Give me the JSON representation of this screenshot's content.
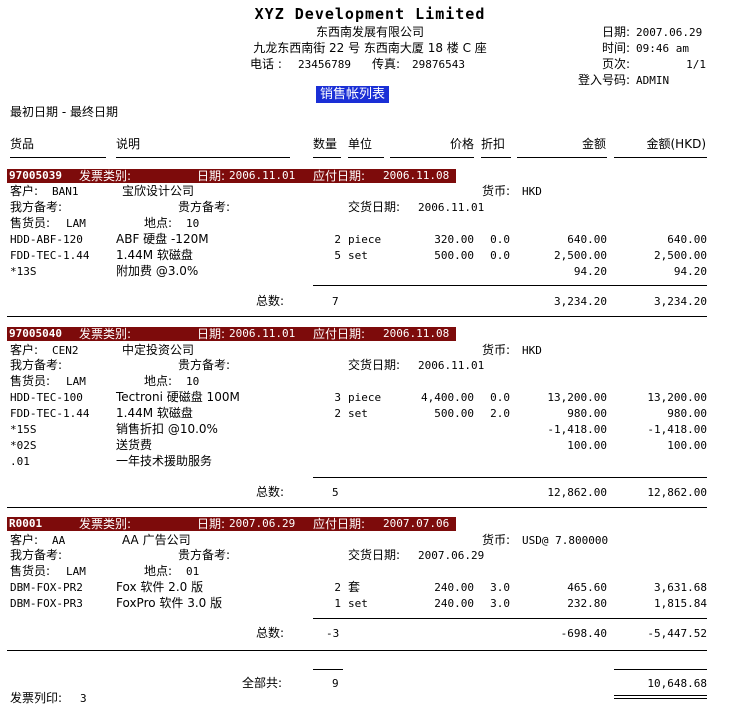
{
  "header": {
    "company_en": "XYZ Development Limited",
    "company_cn": "东西南发展有限公司",
    "address": "九龙东西南街 22 号 东西南大厦 18 楼 C 座",
    "phone_label": "电话 :",
    "phone": "23456789",
    "fax_label": "传真:",
    "fax": "29876543",
    "report_title": "销售帐列表",
    "date_range": "最初日期 - 最终日期",
    "meta": [
      {
        "label": "日期:",
        "value": "2007.06.29"
      },
      {
        "label": "时间:",
        "value": "09:46 am"
      },
      {
        "label": "页次:",
        "value": "1/1"
      },
      {
        "label": "登入号码:",
        "value": "ADMIN"
      }
    ]
  },
  "columns": {
    "item": "货品",
    "desc": "说明",
    "qty": "数量",
    "unit": "单位",
    "price": "价格",
    "discount": "折扣",
    "amount": "金额",
    "amount_hkd": "金额(HKD)"
  },
  "labels": {
    "invoice_type": "发票类别:",
    "date": "日期:",
    "due_date": "应付日期:",
    "customer": "客户:",
    "our_ref": "我方备考:",
    "your_ref": "贵方备考:",
    "delivery_date": "交货日期:",
    "currency": "货币:",
    "salesman": "售货员:",
    "location": "地点:",
    "subtotal": "总数:",
    "grand_total": "全部共:",
    "print_count_label": "发票列印:"
  },
  "invoices": [
    {
      "no": "97005039",
      "date": "2006.11.01",
      "due": "2006.11.08",
      "customer_code": "BAN1",
      "customer_name": "宝欣设计公司",
      "currency": "HKD",
      "delivery": "2006.11.01",
      "salesman": "LAM",
      "location": "10",
      "lines": [
        {
          "item": "HDD-ABF-120",
          "desc": "ABF 硬盘 -120M",
          "qty": "2",
          "unit": "piece",
          "price": "320.00",
          "disc": "0.0",
          "amount": "640.00",
          "hkd": "640.00"
        },
        {
          "item": "FDD-TEC-1.44",
          "desc": "1.44M 软磁盘",
          "qty": "5",
          "unit": "set",
          "price": "500.00",
          "disc": "0.0",
          "amount": "2,500.00",
          "hkd": "2,500.00"
        },
        {
          "item": "*13S",
          "desc": "附加费 @3.0%",
          "qty": "",
          "unit": "",
          "price": "",
          "disc": "",
          "amount": "94.20",
          "hkd": "94.20"
        }
      ],
      "total_qty": "7",
      "total_amount": "3,234.20",
      "total_hkd": "3,234.20"
    },
    {
      "no": "97005040",
      "date": "2006.11.01",
      "due": "2006.11.08",
      "customer_code": "CEN2",
      "customer_name": "中定投资公司",
      "currency": "HKD",
      "delivery": "2006.11.01",
      "salesman": "LAM",
      "location": "10",
      "lines": [
        {
          "item": "HDD-TEC-100",
          "desc": "Tectroni 硬磁盘 100M",
          "qty": "3",
          "unit": "piece",
          "price": "4,400.00",
          "disc": "0.0",
          "amount": "13,200.00",
          "hkd": "13,200.00"
        },
        {
          "item": "FDD-TEC-1.44",
          "desc": "1.44M 软磁盘",
          "qty": "2",
          "unit": "set",
          "price": "500.00",
          "disc": "2.0",
          "amount": "980.00",
          "hkd": "980.00"
        },
        {
          "item": "*15S",
          "desc": "销售折扣 @10.0%",
          "qty": "",
          "unit": "",
          "price": "",
          "disc": "",
          "amount": "-1,418.00",
          "hkd": "-1,418.00"
        },
        {
          "item": "*02S",
          "desc": "送货费",
          "qty": "",
          "unit": "",
          "price": "",
          "disc": "",
          "amount": "100.00",
          "hkd": "100.00"
        },
        {
          "item": ".01",
          "desc": "一年技术援助服务",
          "qty": "",
          "unit": "",
          "price": "",
          "disc": "",
          "amount": "",
          "hkd": ""
        }
      ],
      "total_qty": "5",
      "total_amount": "12,862.00",
      "total_hkd": "12,862.00"
    },
    {
      "no": "R0001",
      "date": "2007.06.29",
      "due": "2007.07.06",
      "customer_code": "AA",
      "customer_name": "AA 广告公司",
      "currency": "USD@  7.800000",
      "delivery": "2007.06.29",
      "salesman": "LAM",
      "location": "01",
      "lines": [
        {
          "item": "DBM-FOX-PR2",
          "desc": "Fox 软件 2.0 版",
          "qty": "2",
          "unit": "套",
          "price": "240.00",
          "disc": "3.0",
          "amount": "465.60",
          "hkd": "3,631.68"
        },
        {
          "item": "DBM-FOX-PR3",
          "desc": "FoxPro 软件 3.0 版",
          "qty": "1",
          "unit": "set",
          "price": "240.00",
          "disc": "3.0",
          "amount": "232.80",
          "hkd": "1,815.84"
        }
      ],
      "total_qty": "-3",
      "total_amount": "-698.40",
      "total_hkd": "-5,447.52"
    }
  ],
  "grand_total": {
    "qty": "9",
    "hkd": "10,648.68"
  },
  "print_count": "3"
}
